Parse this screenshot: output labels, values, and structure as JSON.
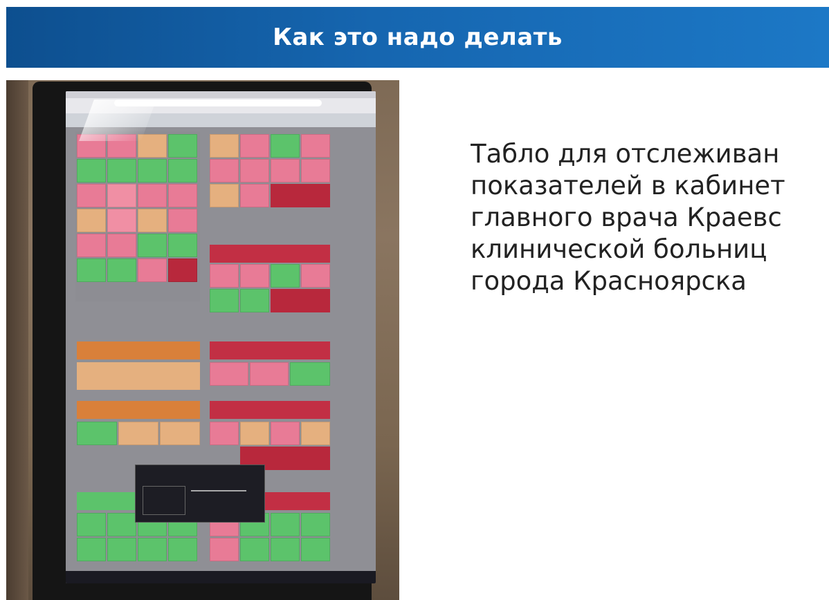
{
  "header": {
    "title": "Как это надо делать"
  },
  "caption": {
    "lines": [
      "Табло для отслеживан",
      "показателей в кабинет",
      "главного врача Краевс",
      "клинической больниц",
      "города Красноярска"
    ]
  },
  "photo": {
    "description_icon": "photo-of-dashboard-monitor"
  },
  "colors": {
    "header_bg": "#1666b0",
    "tile_green": "#5cc36b",
    "tile_pink": "#e87b96",
    "tile_orange": "#e5b07f",
    "tile_red": "#b8283c"
  }
}
